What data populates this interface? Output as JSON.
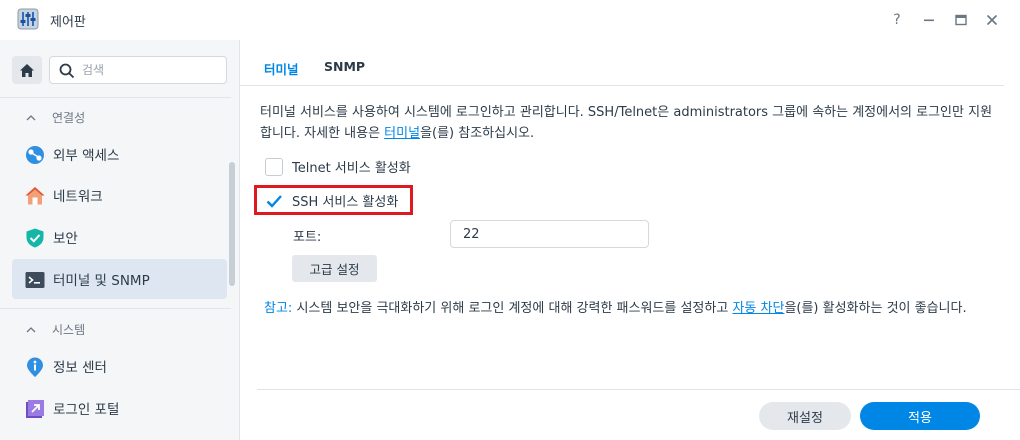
{
  "window": {
    "title": "제어판",
    "icon": "control-panel-icon",
    "buttons": {
      "help": "?",
      "minimize": "‒",
      "maximize": "□",
      "close": "×"
    }
  },
  "sidebar": {
    "search_placeholder": "검색",
    "sections": [
      {
        "label": "연결성",
        "collapsed": false
      },
      {
        "label": "시스템",
        "collapsed": false
      }
    ],
    "items": [
      {
        "label": "외부 액세스",
        "icon": "external-access-icon",
        "active": false
      },
      {
        "label": "네트워크",
        "icon": "network-house-icon",
        "active": false
      },
      {
        "label": "보안",
        "icon": "security-shield-icon",
        "active": false
      },
      {
        "label": "터미널 및 SNMP",
        "icon": "terminal-icon",
        "active": true
      },
      {
        "label": "정보 센터",
        "icon": "info-center-icon",
        "active": false
      },
      {
        "label": "로그인 포털",
        "icon": "login-portal-icon",
        "active": false
      }
    ]
  },
  "tabs": [
    {
      "label": "터미널",
      "active": true
    },
    {
      "label": "SNMP",
      "active": false
    }
  ],
  "description": {
    "text_1": "터미널 서비스를 사용하여 시스템에 로그인하고 관리합니다. SSH/Telnet은 administrators 그룹에 속하는 계정에서의 로그인만 지원합니다. 자세한 내용은 ",
    "link": "터미널",
    "text_2": "을(를) 참조하십시오."
  },
  "telnet": {
    "label": "Telnet 서비스 활성화",
    "checked": false
  },
  "ssh": {
    "label": "SSH 서비스 활성화",
    "checked": true
  },
  "port": {
    "label": "포트:",
    "value": "22"
  },
  "advanced_button": "고급 설정",
  "note": {
    "label": "참고:",
    "text_1": " 시스템 보안을 극대화하기 위해 로그인 계정에 대해 강력한 패스워드를 설정하고 ",
    "link": "자동 차단",
    "text_2": "을(를) 활성화하는 것이 좋습니다."
  },
  "footer": {
    "reset_label": "재설정",
    "apply_label": "적용"
  },
  "colors": {
    "accent": "#0086e5",
    "highlight": "#e0191e",
    "sidebar_bg": "#f4f6f8",
    "active_item_bg": "#dde6f1"
  }
}
